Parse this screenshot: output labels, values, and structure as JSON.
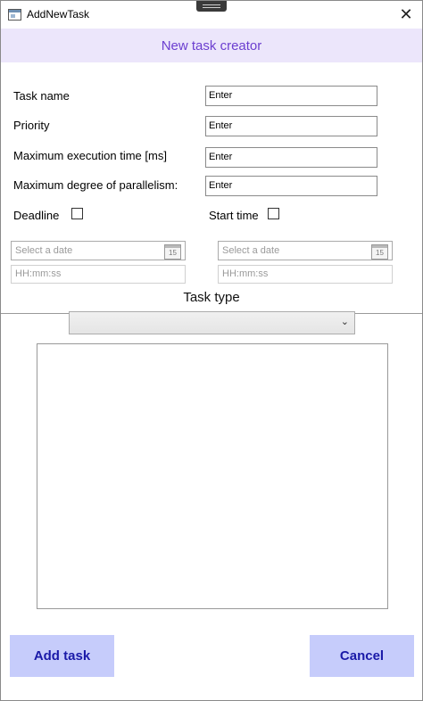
{
  "window": {
    "title": "AddNewTask",
    "close_glyph": "✕"
  },
  "header": {
    "title": "New task creator"
  },
  "form": {
    "task_name": {
      "label": "Task name",
      "value": "Enter"
    },
    "priority": {
      "label": "Priority",
      "value": "Enter"
    },
    "max_exec_time": {
      "label": "Maximum execution time [ms]",
      "value": "Enter"
    },
    "max_parallelism": {
      "label": "Maximum degree of parallelism:",
      "value": "Enter"
    },
    "deadline": {
      "label": "Deadline",
      "checked": false,
      "date_placeholder": "Select a date",
      "time_placeholder": "HH:mm:ss",
      "calendar_day": "15"
    },
    "start_time": {
      "label": "Start time",
      "checked": false,
      "date_placeholder": "Select a date",
      "time_placeholder": "HH:mm:ss",
      "calendar_day": "15"
    }
  },
  "task_type": {
    "label": "Task type",
    "selected": "",
    "chevron": "⌄"
  },
  "buttons": {
    "add": "Add task",
    "cancel": "Cancel"
  },
  "icons": {
    "window_icon": "app-window-icon",
    "calendar": "calendar-icon",
    "chevron": "chevron-down-icon",
    "close": "close-icon"
  },
  "colors": {
    "header_bg": "#ece6fb",
    "header_text": "#6c3fd0",
    "button_bg": "#c6ccfb",
    "button_text": "#1a1aa8"
  }
}
